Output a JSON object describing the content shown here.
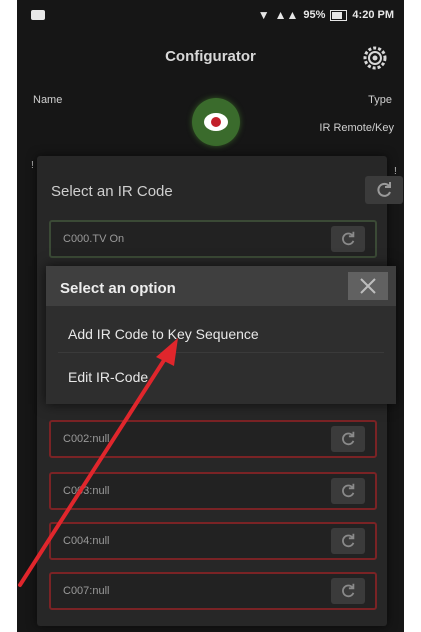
{
  "status_bar": {
    "battery_percent": "95%",
    "time": "4:20 PM"
  },
  "header": {
    "title": "Configurator"
  },
  "device": {
    "name_label": "Name",
    "type_label": "Type",
    "type_value": "IR Remote/Key"
  },
  "ir_dialog": {
    "title": "Select an IR Code",
    "codes": [
      {
        "label": "C000.TV On"
      },
      {
        "label": "C002:null"
      },
      {
        "label": "C003:null"
      },
      {
        "label": "C004:null"
      },
      {
        "label": "C007:null"
      }
    ]
  },
  "option_dialog": {
    "title": "Select an option",
    "options": [
      {
        "label": "Add IR Code to Key Sequence"
      },
      {
        "label": "Edit IR-Code"
      }
    ]
  },
  "colors": {
    "accent_green": "#3a6b2c",
    "arrow_red": "#e0262c",
    "row_border_red": "#7a2325"
  },
  "icons": [
    "gear-icon",
    "eye-icon",
    "refresh-icon",
    "close-icon",
    "wifi-icon",
    "signal-icon",
    "battery-icon"
  ]
}
